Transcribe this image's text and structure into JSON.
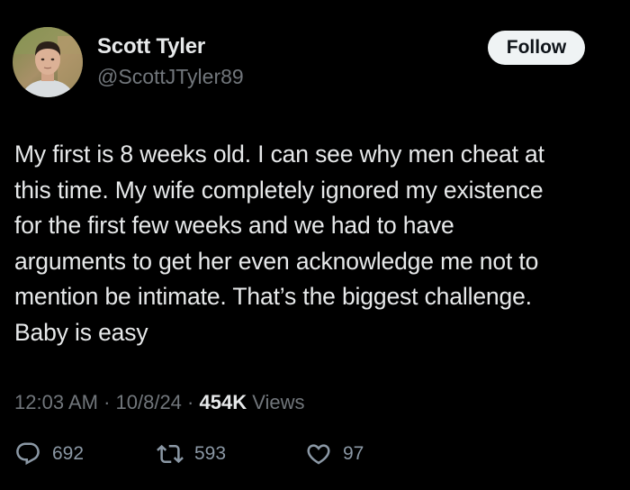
{
  "user": {
    "display_name": "Scott Tyler",
    "handle": "@ScottJTyler89"
  },
  "follow_button": {
    "label": "Follow"
  },
  "tweet": {
    "text": "My first is 8 weeks old. I can see why men cheat at\nthis time. My wife completely ignored my existence\nfor the first few weeks and we had to have\narguments to get her even acknowledge me not to\nmention be intimate. That’s the biggest challenge.\nBaby is easy"
  },
  "meta": {
    "time": "12:03 AM",
    "date": "10/8/24",
    "separator": " · ",
    "views_count": "454K",
    "views_label": " Views"
  },
  "actions": {
    "replies": {
      "icon": "reply-icon",
      "count": "692"
    },
    "reposts": {
      "icon": "repost-icon",
      "count": "593"
    },
    "likes": {
      "icon": "like-icon",
      "count": "97"
    }
  },
  "colors": {
    "background": "#000000",
    "primary_text": "#e7e9ea",
    "secondary_text": "#71767b",
    "button_bg": "#eff3f4",
    "button_text": "#0f1419"
  }
}
